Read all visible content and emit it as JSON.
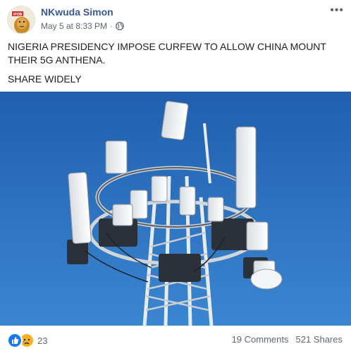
{
  "post": {
    "author": "NKwuda Simon",
    "timestamp": "May 5 at 8:33 PM",
    "separator": "·",
    "privacy_icon": "globe-icon",
    "avatar_badge": "IPOB",
    "more_icon": "more-options-icon",
    "more_glyph": "•••",
    "text_lines": [
      "NIGERIA PRESIDENCY IMPOSE CURFEW TO ALLOW CHINA MOUNT THEIR 5G ANTHENA.",
      "SHARE WIDELY"
    ],
    "photo_icon": "cell-tower-photo"
  },
  "engagement": {
    "reaction_icons": [
      "like-reaction-icon",
      "sad-reaction-icon"
    ],
    "reaction_count": "23",
    "comments": "19 Comments",
    "shares": "521 Shares"
  },
  "colors": {
    "author_link": "#385898",
    "meta_text": "#606770",
    "like_blue": "#1877f2",
    "sad_yellow": "#f7b125",
    "sky_blue": "#2f74c0"
  }
}
